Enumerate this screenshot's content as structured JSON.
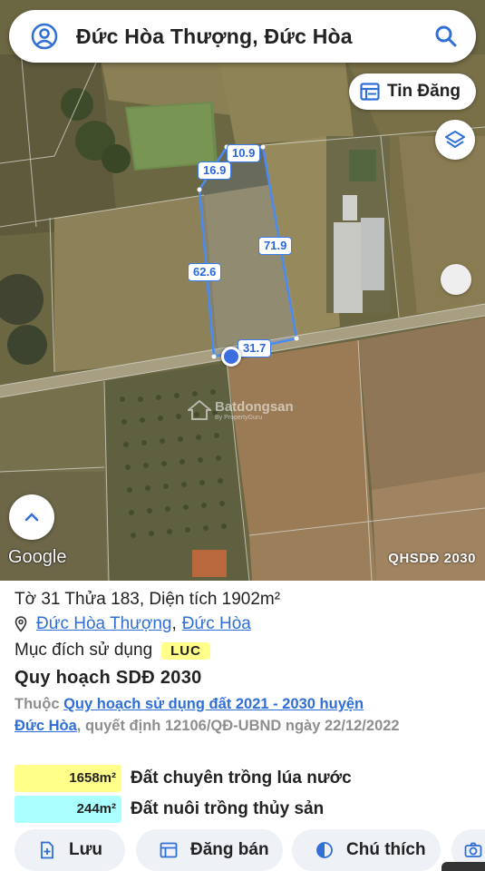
{
  "search": {
    "query": "Đức Hòa Thượng, Đức Hòa"
  },
  "map_controls": {
    "tin_dang_label": "Tin Đăng"
  },
  "map": {
    "labels": {
      "top": "10.9",
      "top_left": "16.9",
      "right": "71.9",
      "left": "62.6",
      "bottom": "31.7"
    },
    "google_label": "Google",
    "plan_code": "QHSDĐ 2030",
    "watermark": "Batdongsan",
    "watermark_sub": "By PropertyGuru"
  },
  "parcel": {
    "title": "Tờ 31 Thửa 183, Diện tích 1902m²",
    "commune": "Đức Hòa Thượng",
    "district": "Đức Hòa",
    "separator": ",",
    "purpose_label": "Mục đích sử dụng",
    "purpose_code": "LUC",
    "plan_title": "Quy hoạch SDĐ 2030",
    "plan_prefix": "Thuộc",
    "plan_link_1": "Quy hoạch sử dụng đất 2021 - 2030 huyện",
    "plan_link_2": "Đức Hòa",
    "plan_suffix": ", quyết định 12106/QĐ-UBND ngày 22/12/2022",
    "zones": [
      {
        "area": "1658m²",
        "name": "Đất chuyên trồng lúa nước",
        "color": "#ffff8a"
      },
      {
        "area": "244m²",
        "name": "Đất nuôi trồng thủy sản",
        "color": "#aaffff"
      }
    ]
  },
  "actions": {
    "save": "Lưu",
    "post": "Đăng bán",
    "legend": "Chú thích"
  },
  "colors": {
    "accent": "#2f6fd6",
    "boundary": "#3b7cf0",
    "button_bg": "#eef1f6"
  }
}
